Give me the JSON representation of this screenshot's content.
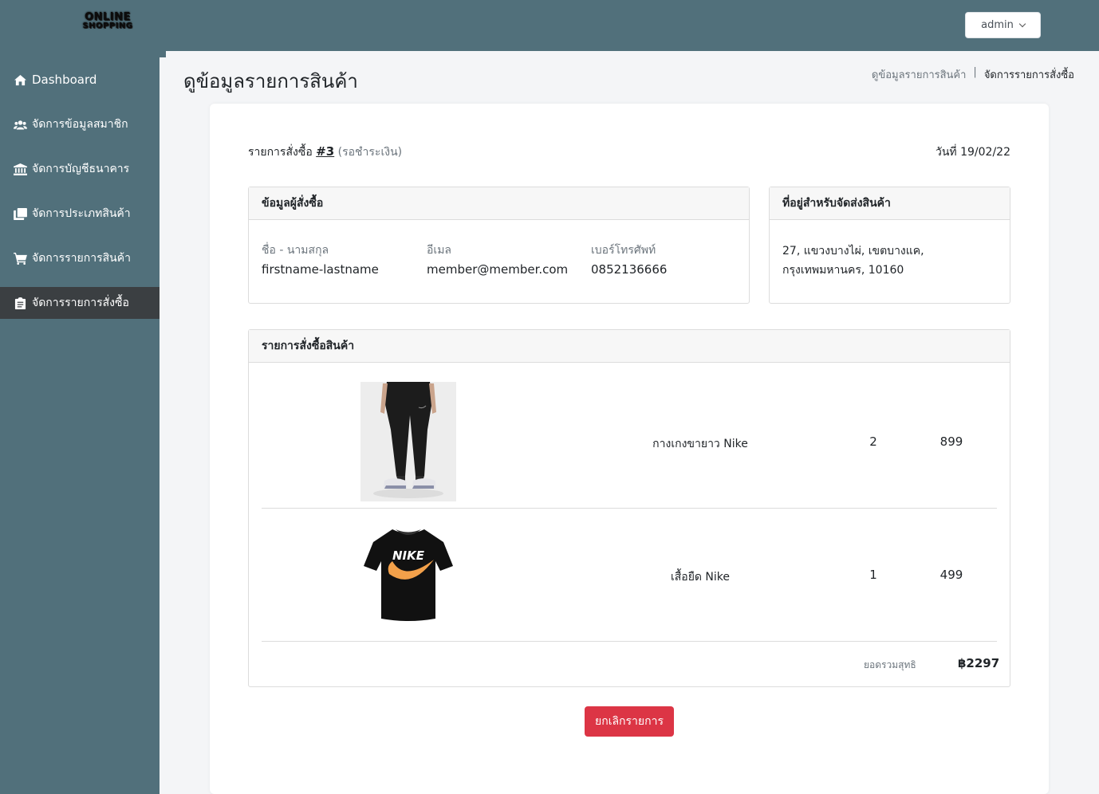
{
  "header": {
    "logo_line1": "ONLINE",
    "logo_line2": "SHOPPING",
    "user_menu_label": "admin"
  },
  "sidebar": {
    "items": [
      {
        "label": "Dashboard",
        "icon": "home-icon"
      },
      {
        "label": "จัดการข้อมูลสมาชิก",
        "icon": "users-icon"
      },
      {
        "label": "จัดการบัญชีธนาคาร",
        "icon": "bank-icon"
      },
      {
        "label": "จัดการประเภทสินค้า",
        "icon": "copy-icon"
      },
      {
        "label": "จัดการรายการสินค้า",
        "icon": "cart-icon"
      },
      {
        "label": "จัดการรายการสั่งซื้อ",
        "icon": "clipboard-icon",
        "active": true
      }
    ]
  },
  "page": {
    "title": "ดูข้อมูลรายการสินค้า",
    "breadcrumb": [
      "ดูข้อมูลรายการสินค้า",
      "จัดการรายการสั่งซื้อ"
    ]
  },
  "order": {
    "prefix": "รายการสั่งซื้อ",
    "number": "#3",
    "status": "(รอชำระเงิน)",
    "date": "วันที่ 19/02/22"
  },
  "buyer": {
    "heading": "ข้อมูลผู้สั่งซื้อ",
    "name_label": "ชื่อ - นามสกุล",
    "name": "firstname-lastname",
    "email_label": "อีเมล",
    "email": "member@member.com",
    "phone_label": "เบอร์โทรศัพท์",
    "phone": "0852136666"
  },
  "shipping": {
    "heading": "ที่อยู่สำหรับจัดส่งสินค้า",
    "line1": "27, แขวงบางไผ่, เขตบางแค,",
    "line2": "กรุงเทพมหานคร, 10160"
  },
  "items": {
    "heading": "รายการสั่งซื้อสินค้า",
    "rows": [
      {
        "name": "กางเกงขายาว Nike",
        "qty": "2",
        "price": "899",
        "image": "pants-image"
      },
      {
        "name": "เสื้อยืด Nike",
        "qty": "1",
        "price": "499",
        "image": "tshirt-image"
      }
    ],
    "total_label": "ยอดรวมสุทธิ",
    "total_value": "฿2297"
  },
  "actions": {
    "cancel_label": "ยกเลิกรายการ"
  },
  "colors": {
    "sidebar": "#51707b",
    "active_nav": "#3b3f42",
    "danger": "#dc3545"
  }
}
